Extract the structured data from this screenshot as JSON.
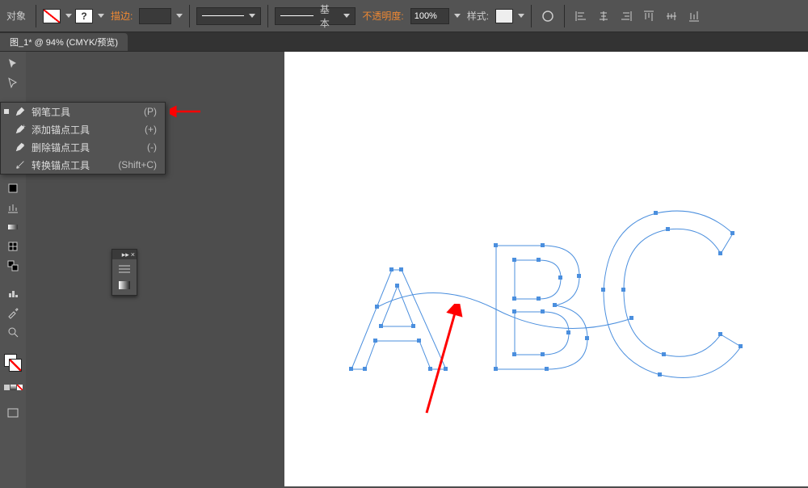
{
  "topbar": {
    "menu_label": "对象",
    "stroke_label": "描边:",
    "stroke_style_label": "基本",
    "opacity_label": "不透明度:",
    "opacity_value": "100%",
    "style_label": "样式:"
  },
  "tab": {
    "title": "图_1* @ 94% (CMYK/预览)"
  },
  "pen_flyout": {
    "items": [
      {
        "name": "钢笔工具",
        "shortcut": "(P)"
      },
      {
        "name": "添加锚点工具",
        "shortcut": "(+)"
      },
      {
        "name": "删除锚点工具",
        "shortcut": "(-)"
      },
      {
        "name": "转换锚点工具",
        "shortcut": "(Shift+C)"
      }
    ]
  }
}
